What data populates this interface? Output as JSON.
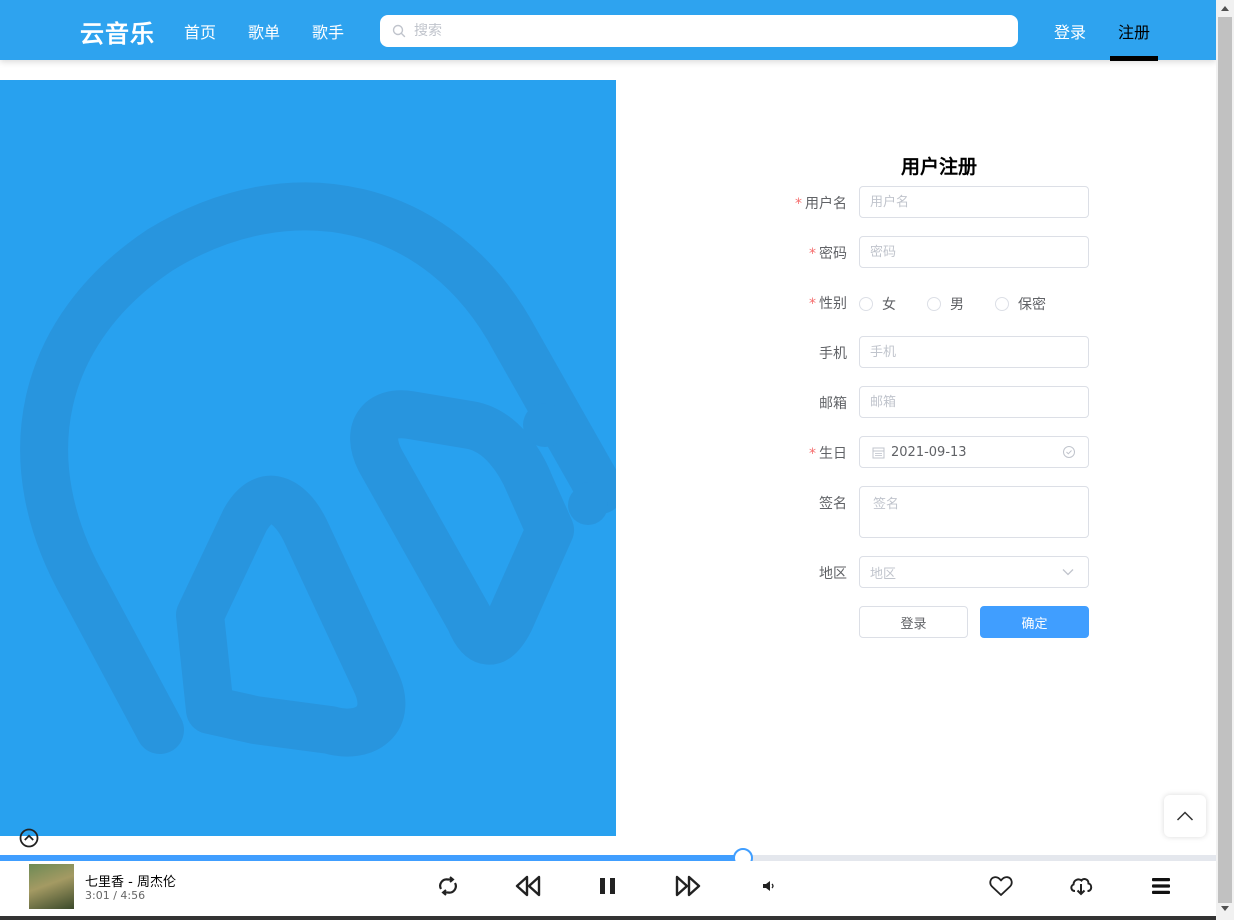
{
  "header": {
    "logo": "云音乐",
    "nav": [
      "首页",
      "歌单",
      "歌手"
    ],
    "search_placeholder": "搜索",
    "login": "登录",
    "register": "注册"
  },
  "form": {
    "title": "用户注册",
    "username": {
      "label": "用户名",
      "placeholder": "用户名"
    },
    "password": {
      "label": "密码",
      "placeholder": "密码"
    },
    "gender": {
      "label": "性别",
      "options": [
        "女",
        "男",
        "保密"
      ]
    },
    "phone": {
      "label": "手机",
      "placeholder": "手机"
    },
    "email": {
      "label": "邮箱",
      "placeholder": "邮箱"
    },
    "birthday": {
      "label": "生日",
      "value": "2021-09-13"
    },
    "signature": {
      "label": "签名",
      "placeholder": "签名"
    },
    "region": {
      "label": "地区",
      "placeholder": "地区"
    },
    "login_button": "登录",
    "confirm_button": "确定"
  },
  "player": {
    "song": "七里香 - 周杰伦",
    "time": "3:01 / 4:56",
    "progress_fraction": 0.611
  },
  "colors": {
    "header": "#2ea3ef",
    "hero": "#28a1ef",
    "primary": "#409eff",
    "required": "#f56c6c"
  }
}
